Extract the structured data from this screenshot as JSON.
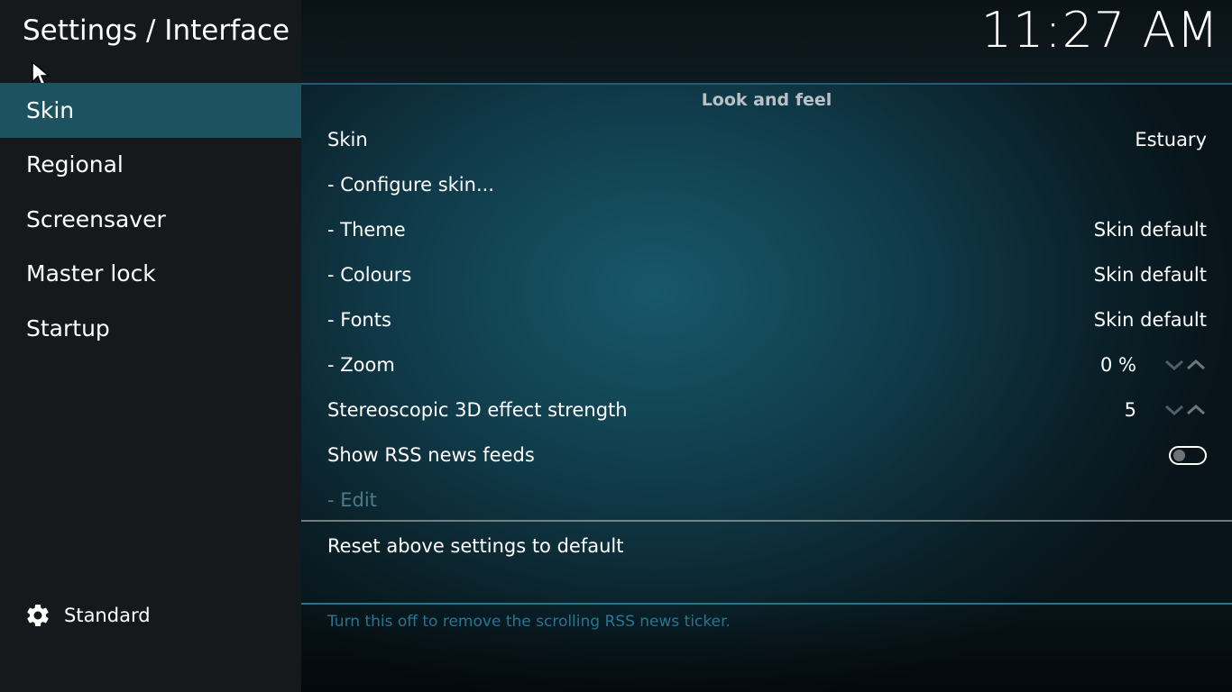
{
  "header": {
    "title": "Settings / Interface",
    "clock": "11:27 AM"
  },
  "sidebar": {
    "items": [
      {
        "label": "Skin",
        "active": true
      },
      {
        "label": "Regional",
        "active": false
      },
      {
        "label": "Screensaver",
        "active": false
      },
      {
        "label": "Master lock",
        "active": false
      },
      {
        "label": "Startup",
        "active": false
      }
    ],
    "settings_level": {
      "icon": "gear-icon",
      "label": "Standard"
    }
  },
  "main": {
    "section_heading": "Look and feel",
    "rows": [
      {
        "label": "Skin",
        "value": "Estuary"
      },
      {
        "label": "- Configure skin...",
        "value": ""
      },
      {
        "label": "- Theme",
        "value": "Skin default"
      },
      {
        "label": "- Colours",
        "value": "Skin default"
      },
      {
        "label": "- Fonts",
        "value": "Skin default"
      },
      {
        "label": "- Zoom",
        "value": "0 %"
      },
      {
        "label": "Stereoscopic 3D effect strength",
        "value": "5"
      },
      {
        "label": "Show RSS news feeds",
        "value": "",
        "toggle_on": false
      },
      {
        "label": "- Edit",
        "value": "",
        "disabled": true
      }
    ],
    "reset_label": "Reset above settings to default",
    "help_text": "Turn this off to remove the scrolling RSS news ticker."
  },
  "colors": {
    "sidebar_bg": "#15191c",
    "active_item_bg": "#1d5261",
    "main_bg": "#103b4a",
    "accent": "#2e8bb0",
    "disabled_text": "#4e7a88"
  }
}
